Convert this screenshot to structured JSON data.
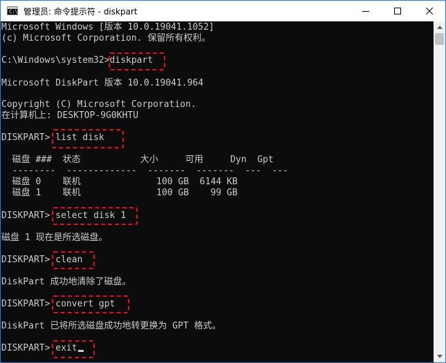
{
  "window": {
    "title": "管理员: 命令提示符 - diskpart",
    "app_icon_glyph": "C:\\",
    "icons": [
      "cmd-app-icon",
      "minimize-icon",
      "maximize-icon",
      "close-icon",
      "scroll-up-icon",
      "scroll-down-icon"
    ]
  },
  "colors": {
    "console_bg": "#0c0c0c",
    "console_text": "#cccccc",
    "highlight_border": "#e0101b",
    "window_border": "#2b79d8"
  },
  "console": {
    "header_line1": "Microsoft Windows [版本 10.0.19041.1052]",
    "header_line2": "(c) Microsoft Corporation. 保留所有权利。",
    "prompt_system": "C:\\Windows\\system32>",
    "cmd_diskpart": "diskpart",
    "diskpart_version": "Microsoft DiskPart 版本 10.0.19041.964",
    "copyright": "Copyright (C) Microsoft Corporation.",
    "computer_line": "在计算机上: DESKTOP-9G0KHTU",
    "prompt": "DISKPART> ",
    "cmd_list_disk": "list disk",
    "disk_table": {
      "header": "  磁盘 ###  状态           大小     可用     Dyn  Gpt",
      "separator": "  --------  -------------  -------  -------  ---  ---",
      "rows": [
        "  磁盘 0    联机              100 GB  6144 KB",
        "  磁盘 1    联机              100 GB    99 GB"
      ]
    },
    "cmd_select_disk": "select disk 1",
    "select_result": "磁盘 1 现在是所选磁盘。",
    "cmd_clean": "clean",
    "clean_result": "DiskPart 成功地清除了磁盘。",
    "cmd_convert": "convert gpt",
    "convert_result": "DiskPart 已将所选磁盘成功地转更换为 GPT 格式。",
    "cmd_exit": "exit"
  }
}
